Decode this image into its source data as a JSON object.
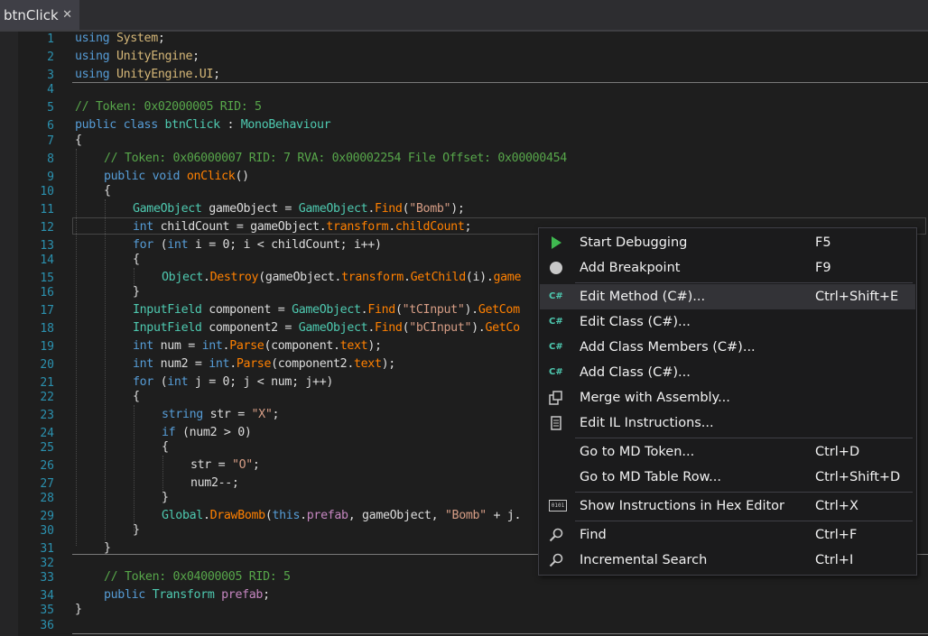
{
  "tab": {
    "title": "btnClick",
    "close": "✕"
  },
  "line_numbers": [
    "1",
    "2",
    "3",
    "4",
    "5",
    "6",
    "7",
    "8",
    "9",
    "10",
    "11",
    "12",
    "13",
    "14",
    "15",
    "16",
    "17",
    "18",
    "19",
    "20",
    "21",
    "22",
    "23",
    "24",
    "25",
    "26",
    "27",
    "28",
    "29",
    "30",
    "31",
    "32",
    "33",
    "34",
    "35",
    "36"
  ],
  "code": {
    "l1_kw": "using",
    "l1_ns": "System",
    "l1_end": ";",
    "l2_kw": "using",
    "l2_ns": "UnityEngine",
    "l2_end": ";",
    "l3_kw": "using",
    "l3_ns": "UnityEngine.UI",
    "l3_end": ";",
    "l5": "// Token: 0x02000005 RID: 5",
    "l6_kw": "public class",
    "l6_name": " btnClick ",
    "l6_colon": ": ",
    "l6_base": "MonoBehaviour",
    "l7": "{",
    "l8": "// Token: 0x06000007 RID: 7 RVA: 0x00002254 File Offset: 0x00000454",
    "l9_kw": "public void",
    "l9_fn": "onClick",
    "l9_end": "()",
    "l10": "{",
    "l11_t": "GameObject",
    "l11_a": " gameObject = ",
    "l11_t2": "GameObject",
    "l11_dot": ".",
    "l11_m": "Find",
    "l11_b": "(",
    "l11_s": "\"Bomb\"",
    "l11_c": ");",
    "l12_kw": "int",
    "l12_a": " childCount = gameObject.",
    "l12_p1": "transform",
    "l12_dot": ".",
    "l12_p2": "childCount",
    "l12_c": ";",
    "l13_kw": "for",
    "l13_a": " (",
    "l13_kw2": "int",
    "l13_b": " i = 0; i < childCount; i++)",
    "l14": "{",
    "l15_t": "Object",
    "l15_dot": ".",
    "l15_m": "Destroy",
    "l15_a": "(gameObject.",
    "l15_p": "transform",
    "l15_dot2": ".",
    "l15_m2": "GetChild",
    "l15_b": "(i).",
    "l15_p2": "game",
    "l16": "}",
    "l17_t": "InputField",
    "l17_a": " component = ",
    "l17_t2": "GameObject",
    "l17_dot": ".",
    "l17_m": "Find",
    "l17_b": "(",
    "l17_s": "\"tCInput\"",
    "l17_c": ").",
    "l17_m2": "GetCom",
    "l18_t": "InputField",
    "l18_a": " component2 = ",
    "l18_t2": "GameObject",
    "l18_dot": ".",
    "l18_m": "Find",
    "l18_b": "(",
    "l18_s": "\"bCInput\"",
    "l18_c": ").",
    "l18_m2": "GetCo",
    "l19_kw": "int",
    "l19_a": " num = ",
    "l19_kw2": "int",
    "l19_dot": ".",
    "l19_m": "Parse",
    "l19_b": "(component.",
    "l19_p": "text",
    "l19_c": ");",
    "l20_kw": "int",
    "l20_a": " num2 = ",
    "l20_kw2": "int",
    "l20_dot": ".",
    "l20_m": "Parse",
    "l20_b": "(component2.",
    "l20_p": "text",
    "l20_c": ");",
    "l21_kw": "for",
    "l21_a": " (",
    "l21_kw2": "int",
    "l21_b": " j = 0; j < num; j++)",
    "l22": "{",
    "l23_kw": "string",
    "l23_a": " str = ",
    "l23_s": "\"X\"",
    "l23_c": ";",
    "l24_kw": "if",
    "l24_a": " (num2 > 0)",
    "l25": "{",
    "l26_a": "str = ",
    "l26_s": "\"O\"",
    "l26_c": ";",
    "l27": "num2--;",
    "l28": "}",
    "l29_t": "Global",
    "l29_dot": ".",
    "l29_m": "DrawBomb",
    "l29_a": "(",
    "l29_kw": "this",
    "l29_dot2": ".",
    "l29_p": "prefab",
    "l29_b": ", gameObject, ",
    "l29_s": "\"Bomb\"",
    "l29_c": " + j.",
    "l30": "}",
    "l31": "}",
    "l33": "// Token: 0x04000005 RID: 5",
    "l34_kw": "public",
    "l34_t": "Transform",
    "l34_p": "prefab",
    "l34_c": ";",
    "l35": "}"
  },
  "context_menu": {
    "items": [
      {
        "label": "Start Debugging",
        "shortcut": "F5",
        "icon": "play-icon"
      },
      {
        "label": "Add Breakpoint",
        "shortcut": "F9",
        "icon": "breakpoint-icon"
      },
      {
        "label": "Edit Method (C#)...",
        "shortcut": "Ctrl+Shift+E",
        "icon": "csharp-icon",
        "icon_text": "C#"
      },
      {
        "label": "Edit Class (C#)...",
        "shortcut": "",
        "icon": "csharp-icon",
        "icon_text": "C#"
      },
      {
        "label": "Add Class Members (C#)...",
        "shortcut": "",
        "icon": "csharp-icon",
        "icon_text": "C#"
      },
      {
        "label": "Add Class (C#)...",
        "shortcut": "",
        "icon": "csharp-icon",
        "icon_text": "C#"
      },
      {
        "label": "Merge with Assembly...",
        "shortcut": "",
        "icon": "merge-icon"
      },
      {
        "label": "Edit IL Instructions...",
        "shortcut": "",
        "icon": "document-icon"
      },
      {
        "label": "Go to MD Token...",
        "shortcut": "Ctrl+D",
        "icon": ""
      },
      {
        "label": "Go to MD Table Row...",
        "shortcut": "Ctrl+Shift+D",
        "icon": ""
      },
      {
        "label": "Show Instructions in Hex Editor",
        "shortcut": "Ctrl+X",
        "icon": "hex-editor-icon",
        "icon_text": "0101"
      },
      {
        "label": "Find",
        "shortcut": "Ctrl+F",
        "icon": "search-icon"
      },
      {
        "label": "Incremental Search",
        "shortcut": "Ctrl+I",
        "icon": "search-icon"
      }
    ]
  },
  "colors": {
    "accent_green": "#4ec9b0",
    "selected_item_bg": "#333337"
  }
}
